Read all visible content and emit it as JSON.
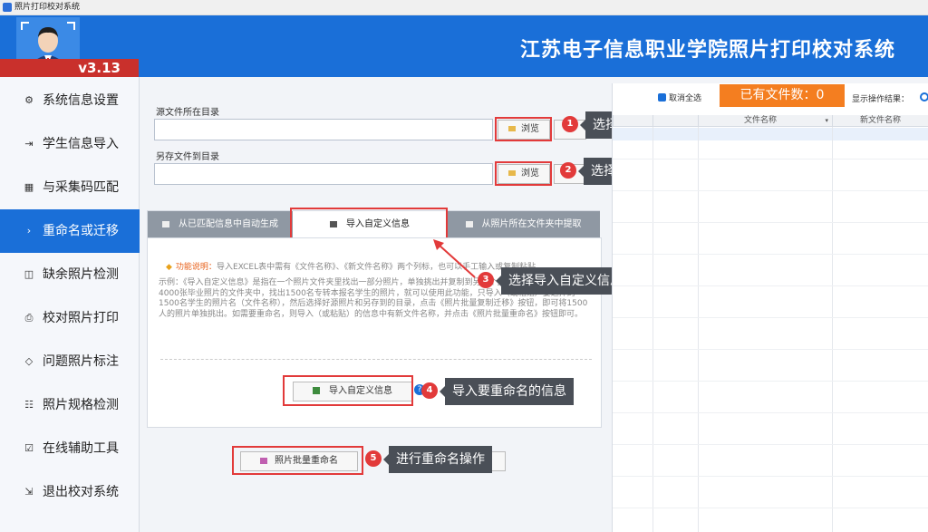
{
  "window": {
    "title": "照片打印校对系统"
  },
  "header": {
    "version": "v3.13",
    "title": "江苏电子信息职业学院照片打印校对系统"
  },
  "sidebar": {
    "items": [
      {
        "label": "系统信息设置",
        "icon": "gear-icon"
      },
      {
        "label": "学生信息导入",
        "icon": "import-icon"
      },
      {
        "label": "与采集码匹配",
        "icon": "grid-icon"
      },
      {
        "label": "重命名或迁移",
        "icon": "arrow-icon"
      },
      {
        "label": "缺余照片检测",
        "icon": "scan-icon"
      },
      {
        "label": "校对照片打印",
        "icon": "print-icon"
      },
      {
        "label": "问题照片标注",
        "icon": "tag-icon"
      },
      {
        "label": "照片规格检测",
        "icon": "list-icon"
      },
      {
        "label": "在线辅助工具",
        "icon": "check-icon"
      },
      {
        "label": "退出校对系统",
        "icon": "exit-icon"
      }
    ],
    "active_index": 3
  },
  "form": {
    "source_label": "源文件所在目录",
    "target_label": "另存文件到目录",
    "browse_label": "浏览"
  },
  "tabs": [
    {
      "label": "从已匹配信息中自动生成"
    },
    {
      "label": "导入自定义信息"
    },
    {
      "label": "从照片所在文件夹中提取"
    }
  ],
  "panel": {
    "func_label": "功能说明：",
    "func_text": "导入EXCEL表中需有《文件名称》、《新文件名称》两个列标，也可以手工输入或复制粘贴。",
    "example_text": "示例：《导入自定义信息》是指在一个照片文件夹里找出一部分照片，单独挑出并复制到另一个文件夹中。例如：想在4000张毕业照片的文件夹中，找出1500名专转本报名学生的照片，就可以使用此功能，只导入（或粘贴）要选择的1500名学生的照片名（文件名称），然后选择好源照片和另存到的目录，点击《照片批量复制迁移》按钮，即可将1500人的照片单独挑出。如需要重命名，则导入（或粘贴）的信息中有新文件名称，并点击《照片批量重命名》按钮即可。",
    "import_button": "导入自定义信息",
    "rename_button": "照片批量重命名"
  },
  "callouts": [
    {
      "num": "1",
      "text": "选择照片存放的位置"
    },
    {
      "num": "2",
      "text": "选择重命名照片存放的位置"
    },
    {
      "num": "3",
      "text": "选择导入自定义信息"
    },
    {
      "num": "4",
      "text": "导入要重命名的信息"
    },
    {
      "num": "5",
      "text": "进行重命名操作"
    }
  ],
  "right": {
    "cancel_all": "取消全选",
    "file_count": "已有文件数：0",
    "show_result": "显示操作结果：",
    "col_filename": "文件名称",
    "col_newname": "新文件名称"
  },
  "colors": {
    "brand": "#1a6fd8",
    "accent": "#f47e20",
    "marker": "#e23a3a"
  }
}
